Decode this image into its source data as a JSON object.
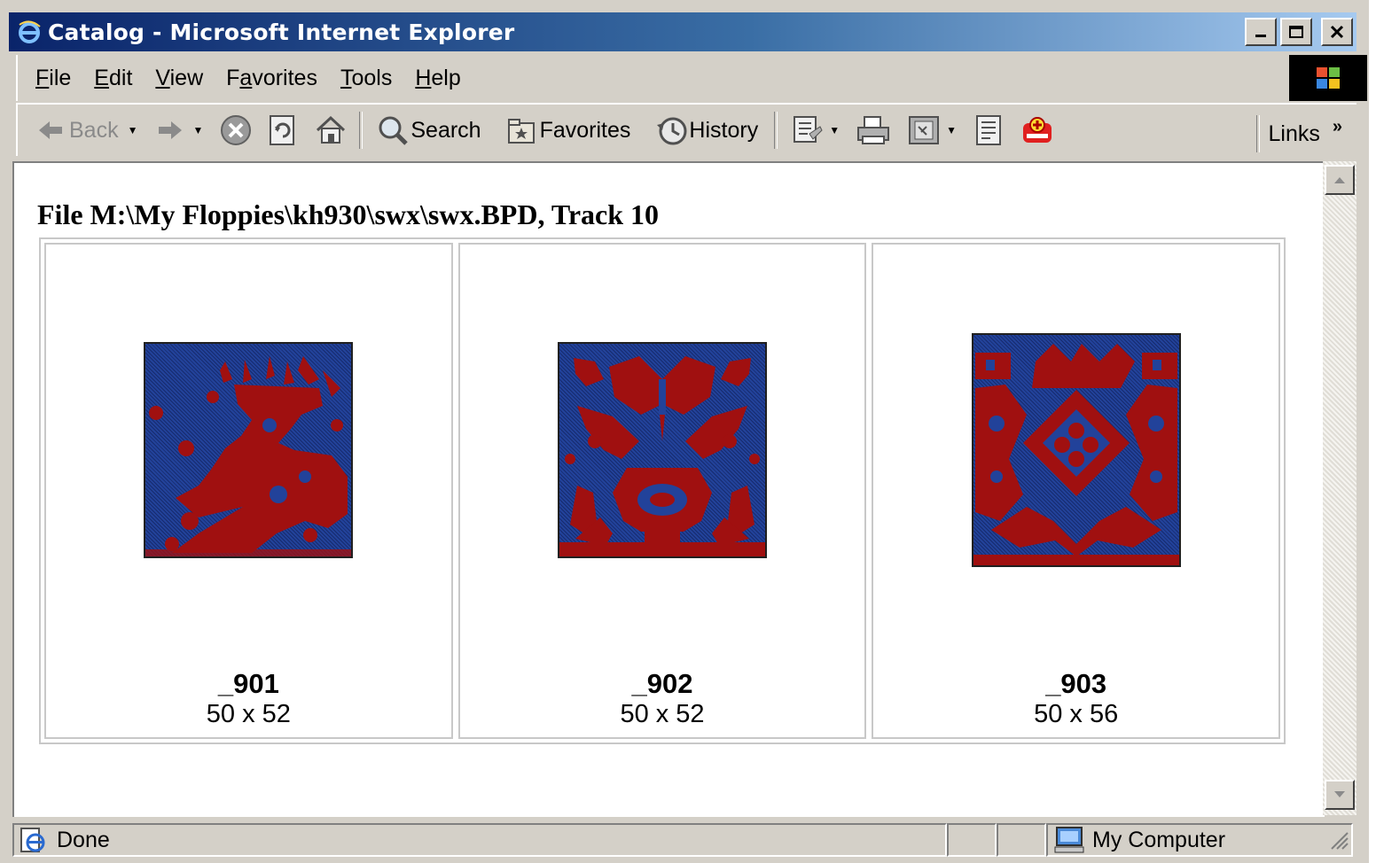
{
  "window": {
    "title": "Catalog - Microsoft Internet Explorer"
  },
  "menu": [
    {
      "pre": "",
      "ul": "F",
      "post": "ile"
    },
    {
      "pre": "",
      "ul": "E",
      "post": "dit"
    },
    {
      "pre": "",
      "ul": "V",
      "post": "iew"
    },
    {
      "pre": "F",
      "ul": "a",
      "post": "vorites"
    },
    {
      "pre": "",
      "ul": "T",
      "post": "ools"
    },
    {
      "pre": "",
      "ul": "H",
      "post": "elp"
    }
  ],
  "toolbar": {
    "back": "Back",
    "search": "Search",
    "favorites": "Favorites",
    "history": "History",
    "links": "Links"
  },
  "page": {
    "heading": "File M:\\My Floppies\\kh930\\swx\\swx.BPD, Track 10",
    "items": [
      {
        "name": "_901",
        "size": "50 x 52",
        "motif": "deer"
      },
      {
        "name": "_902",
        "size": "50 x 52",
        "motif": "vase"
      },
      {
        "name": "_903",
        "size": "50 x 56",
        "motif": "medallion"
      }
    ]
  },
  "colors": {
    "pattern_blue": "#22429a",
    "pattern_red": "#a01010",
    "title_bar": "#0a246a"
  },
  "status": {
    "text": "Done",
    "zone": "My Computer"
  }
}
